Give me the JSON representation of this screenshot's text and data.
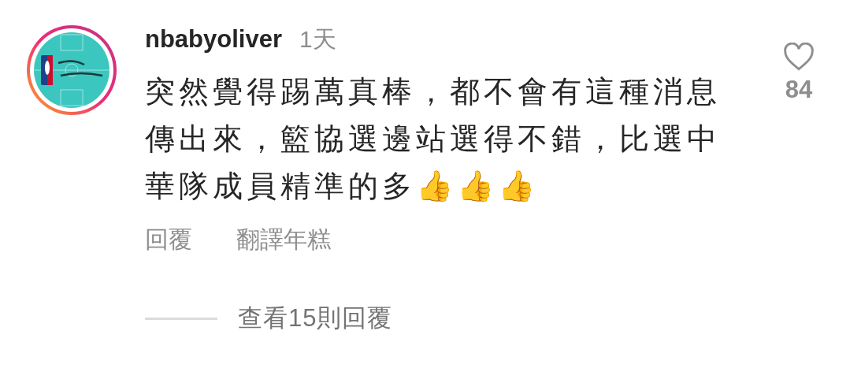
{
  "comment": {
    "username": "nbabyoliver",
    "time": "1天",
    "text": "突然覺得踢萬真棒，都不會有這種消息傳出來，籃協選邊站選得不錯，比選中華隊成員精準的多👍👍👍",
    "like_count": "84",
    "liked": false,
    "actions": [
      "回覆",
      "翻譯年糕"
    ],
    "view_replies": "查看15則回覆"
  }
}
